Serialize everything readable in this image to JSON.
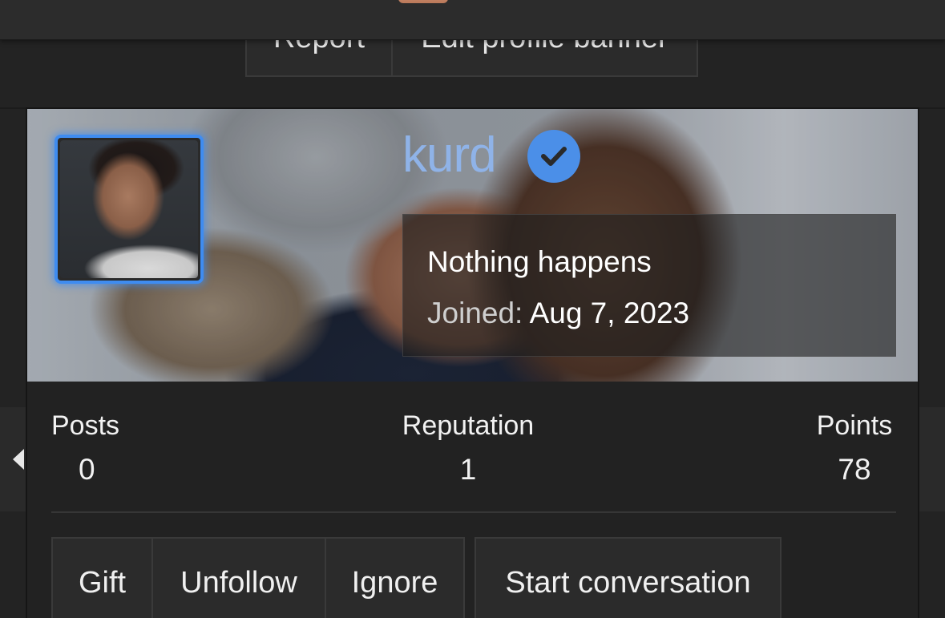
{
  "top_actions": {
    "report_label": "Report",
    "edit_banner_label": "Edit profile banner"
  },
  "profile": {
    "username": "kurd",
    "verified_icon": "check-circle-icon",
    "about": "Nothing happens",
    "joined_label": "Joined:",
    "joined_value": "Aug 7, 2023"
  },
  "stats": [
    {
      "label": "Posts",
      "value": "0"
    },
    {
      "label": "Reputation",
      "value": "1"
    },
    {
      "label": "Points",
      "value": "78"
    }
  ],
  "actions": {
    "gift": "Gift",
    "unfollow": "Unfollow",
    "ignore": "Ignore",
    "start_conversation": "Start conversation"
  },
  "colors": {
    "accent": "#4b8fe8",
    "username": "#8fb3e8",
    "background": "#232323"
  }
}
